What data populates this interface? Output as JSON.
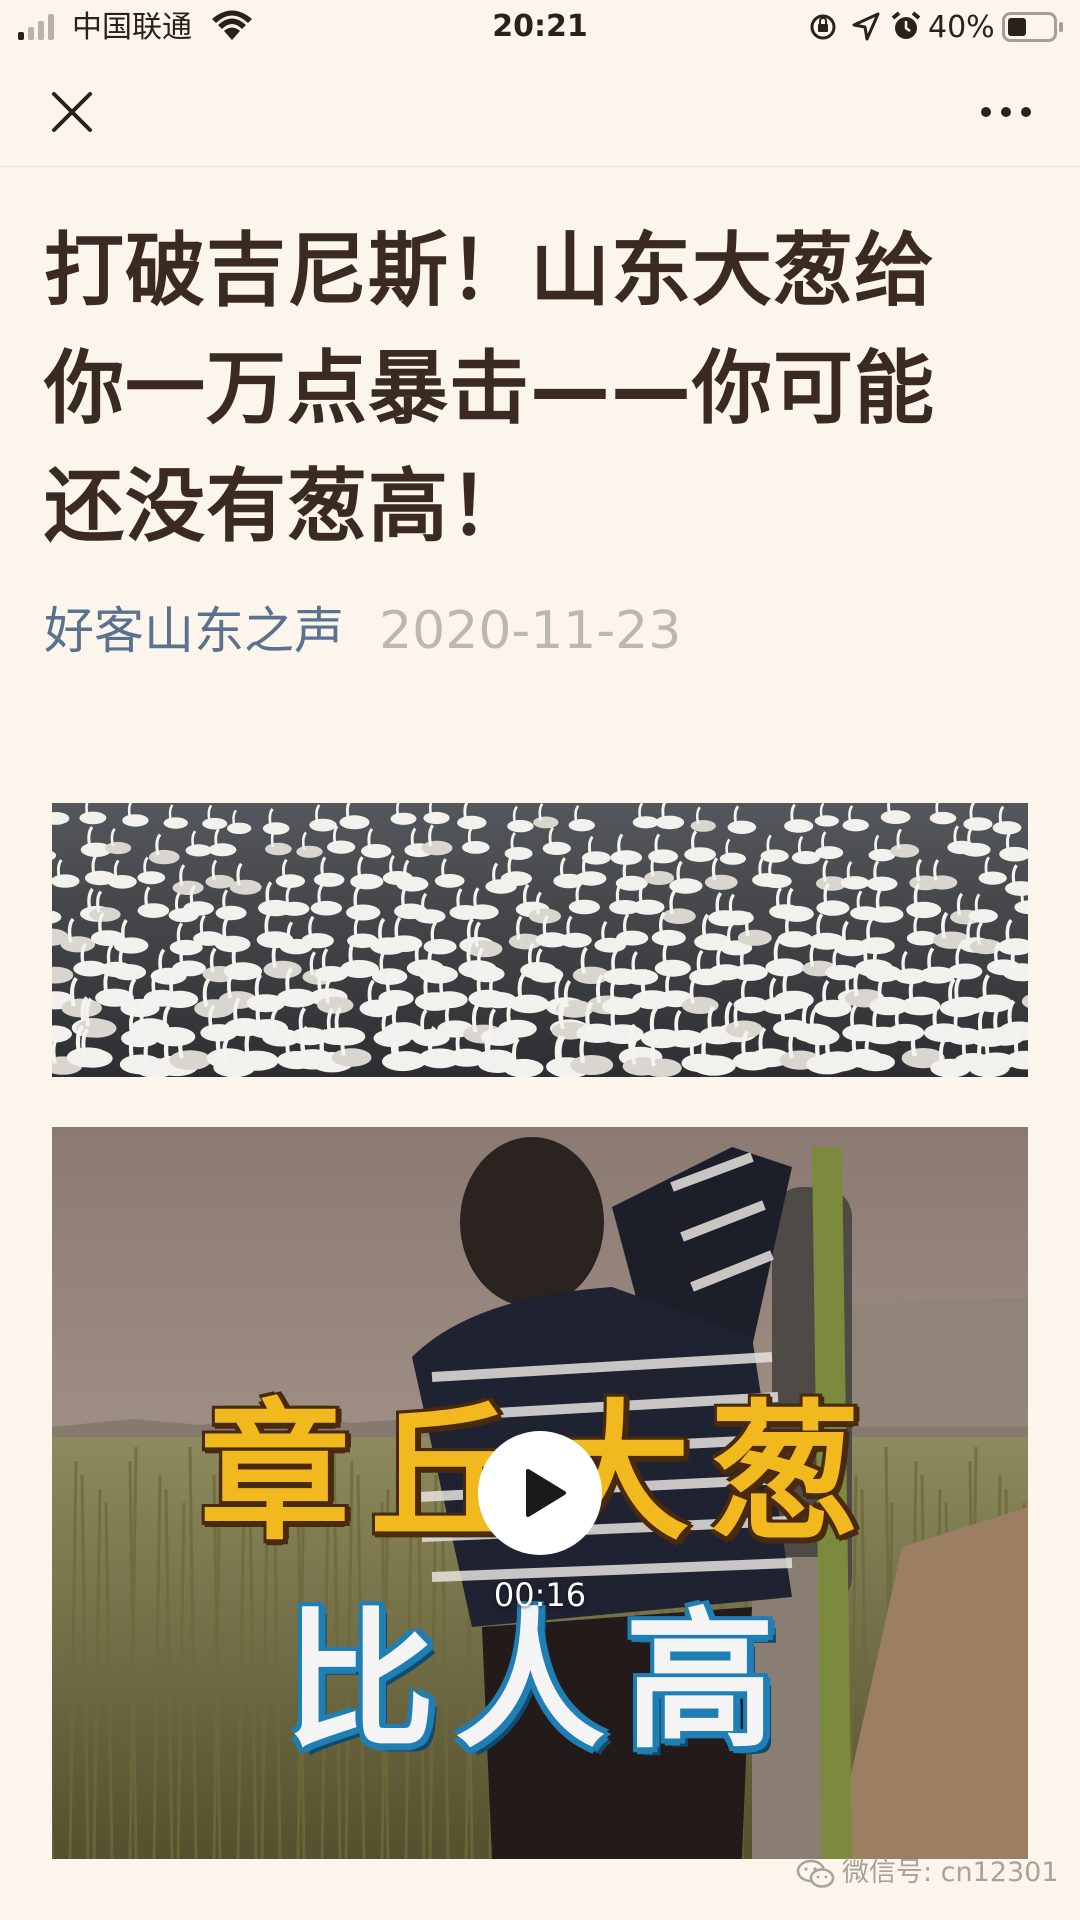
{
  "status_bar": {
    "carrier": "中国联通",
    "time": "20:21",
    "battery": "40%",
    "battery_level": 0.4,
    "icons": [
      "signal-icon",
      "wifi-icon",
      "rotation-lock-icon",
      "location-icon",
      "alarm-icon",
      "battery-icon"
    ]
  },
  "nav": {
    "close_icon": "close-icon",
    "more_icon": "more-icon"
  },
  "article": {
    "title": "打破吉尼斯！山东大葱给你一万点暴击——你可能还没有葱高！",
    "author": "好客山东之声",
    "date": "2020-11-23"
  },
  "video": {
    "caption_line1": "章丘大葱",
    "caption_line2": "比人高",
    "duration": "00:16",
    "play_icon": "play-icon"
  },
  "watermark": {
    "text": "微信号: cn12301"
  },
  "colors": {
    "background": "#fbf5eb",
    "title": "#3b2a21",
    "author_link": "#5a7290",
    "date": "#bfb7ad",
    "caption_yellow": "#f2b91e",
    "caption_blue_outline": "#1f7fb4"
  }
}
